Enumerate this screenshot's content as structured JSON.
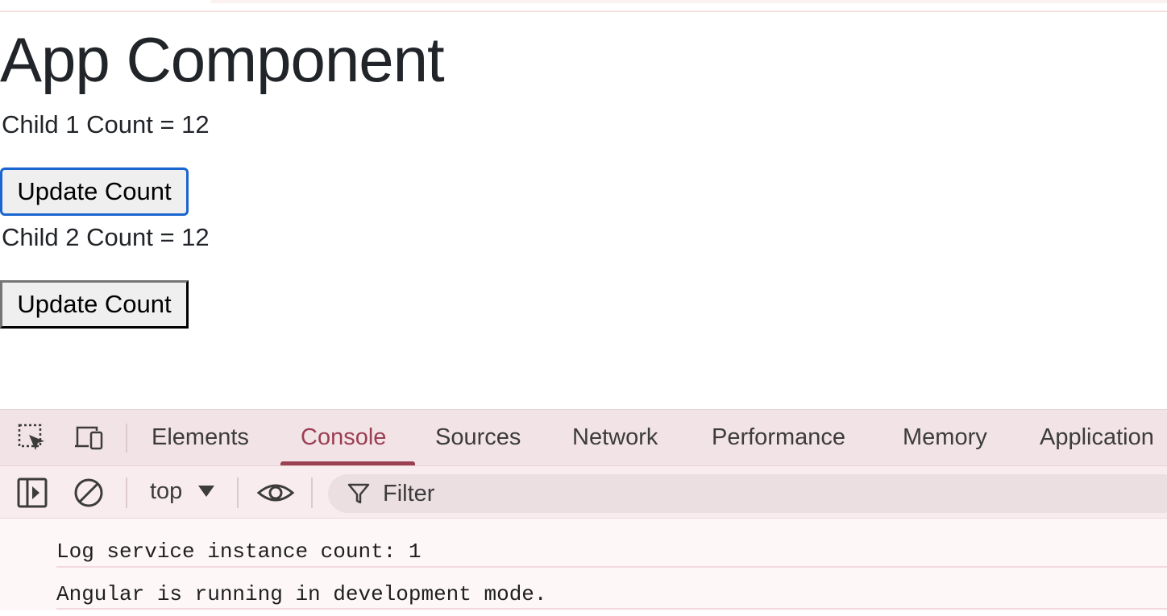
{
  "app": {
    "title": "App Component",
    "child1": {
      "label": "Child 1 Count = 12",
      "button": "Update Count"
    },
    "child2": {
      "label": "Child 2 Count = 12",
      "button": "Update Count"
    }
  },
  "devtools": {
    "tabs": [
      "Elements",
      "Console",
      "Sources",
      "Network",
      "Performance",
      "Memory",
      "Application"
    ],
    "active_tab": "Console",
    "context": "top",
    "filter_placeholder": "Filter",
    "logs": [
      "Log service instance count: 1",
      "Angular is running in development mode."
    ],
    "icons": [
      "inspect-element-icon",
      "device-toolbar-icon",
      "sidebar-toggle-icon",
      "clear-console-icon",
      "live-expression-eye-icon",
      "filter-icon"
    ],
    "colors": {
      "accent": "#9b3f52",
      "focus_ring": "#1a66d0"
    }
  }
}
